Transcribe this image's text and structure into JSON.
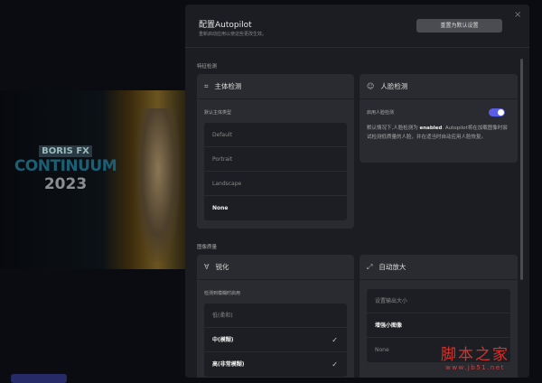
{
  "background": {
    "logo_brand": "BORIS FX",
    "logo_product": "CONTINUUM",
    "logo_year": "2023"
  },
  "modal": {
    "title": "配置Autopilot",
    "subtitle": "重新启动应用以使这些更改生效。",
    "reset_label": "重置为默认设置",
    "close_icon": "×",
    "section1": "特征检测",
    "subject": {
      "title": "主体检测",
      "label": "默认主体类型",
      "options": [
        "Default",
        "Portrait",
        "Landscape",
        "None"
      ],
      "selected": "None"
    },
    "face": {
      "title": "人脸检测",
      "toggle_label": "启用人脸检测",
      "enabled": true,
      "desc_pre": "默认情况下,人脸检测为 ",
      "desc_bold": "enabled",
      "desc_post": ". Autopilot将在加载图像时尝试检测低质量的人脸，并在适当时自动应用人脸恢复。"
    },
    "section2": "图像质量",
    "sharpen": {
      "title": "锐化",
      "label": "检测到模糊时启用",
      "options": [
        "低(柔和)",
        "中(模糊)",
        "高(非常模糊)"
      ],
      "check": "✓"
    },
    "upscale": {
      "title": "自动放大",
      "options": [
        "设置输出大小",
        "增强小图像",
        "None"
      ]
    }
  },
  "watermark": {
    "line1": "脚本之家",
    "line2": "www.jb51.net"
  }
}
